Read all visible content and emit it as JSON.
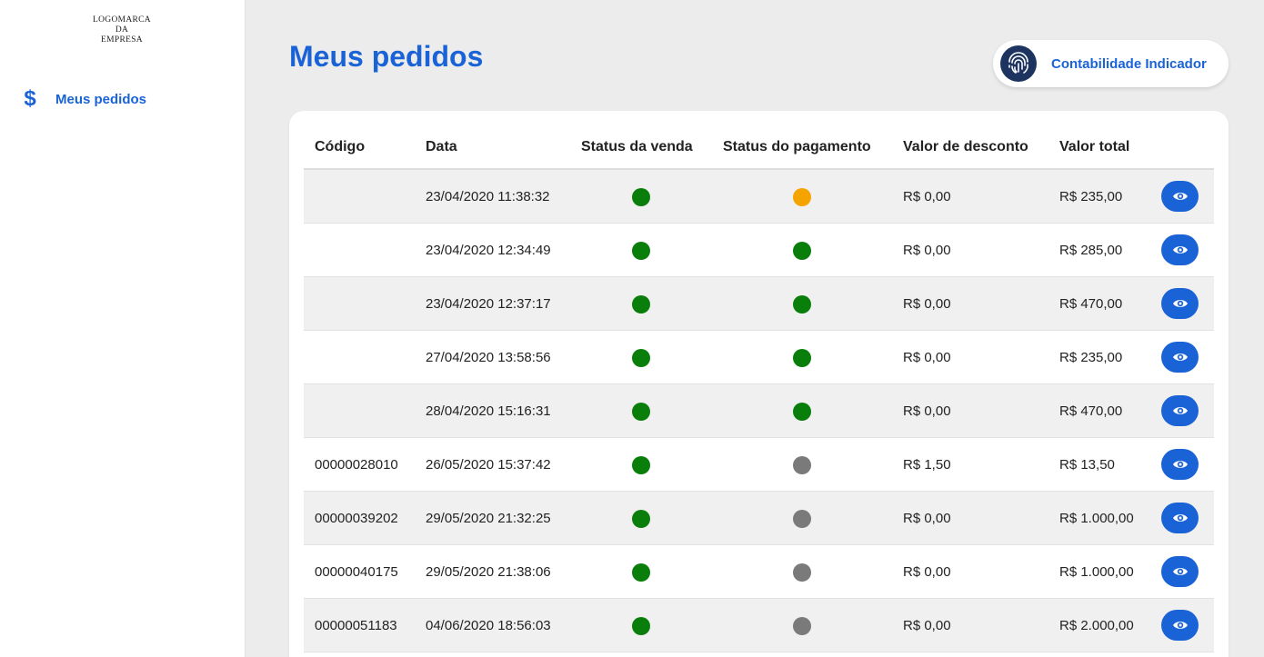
{
  "sidebar": {
    "logo_lines": [
      "LOGOMARCA",
      "DA",
      "EMPRESA"
    ],
    "items": [
      {
        "label": "Meus pedidos",
        "icon": "dollar-icon"
      }
    ]
  },
  "header": {
    "title": "Meus pedidos",
    "account": {
      "name": "Contabilidade Indicador",
      "avatar_icon": "fingerprint-icon"
    }
  },
  "colors": {
    "accent": "#1a63d6",
    "status_ok": "#0a7e0a",
    "status_pending": "#f5a300",
    "status_unknown": "#7a7a7a"
  },
  "table": {
    "columns": [
      "Código",
      "Data",
      "Status da venda",
      "Status do pagamento",
      "Valor de desconto",
      "Valor total"
    ],
    "rows": [
      {
        "codigo": "",
        "data": "23/04/2020 11:38:32",
        "status_venda": "green",
        "status_pagamento": "orange",
        "desconto": "R$ 0,00",
        "total": "R$ 235,00"
      },
      {
        "codigo": "",
        "data": "23/04/2020 12:34:49",
        "status_venda": "green",
        "status_pagamento": "green",
        "desconto": "R$ 0,00",
        "total": "R$ 285,00"
      },
      {
        "codigo": "",
        "data": "23/04/2020 12:37:17",
        "status_venda": "green",
        "status_pagamento": "green",
        "desconto": "R$ 0,00",
        "total": "R$ 470,00"
      },
      {
        "codigo": "",
        "data": "27/04/2020 13:58:56",
        "status_venda": "green",
        "status_pagamento": "green",
        "desconto": "R$ 0,00",
        "total": "R$ 235,00"
      },
      {
        "codigo": "",
        "data": "28/04/2020 15:16:31",
        "status_venda": "green",
        "status_pagamento": "green",
        "desconto": "R$ 0,00",
        "total": "R$ 470,00"
      },
      {
        "codigo": "00000028010",
        "data": "26/05/2020 15:37:42",
        "status_venda": "green",
        "status_pagamento": "gray",
        "desconto": "R$ 1,50",
        "total": "R$ 13,50"
      },
      {
        "codigo": "00000039202",
        "data": "29/05/2020 21:32:25",
        "status_venda": "green",
        "status_pagamento": "gray",
        "desconto": "R$ 0,00",
        "total": "R$ 1.000,00"
      },
      {
        "codigo": "00000040175",
        "data": "29/05/2020 21:38:06",
        "status_venda": "green",
        "status_pagamento": "gray",
        "desconto": "R$ 0,00",
        "total": "R$ 1.000,00"
      },
      {
        "codigo": "00000051183",
        "data": "04/06/2020 18:56:03",
        "status_venda": "green",
        "status_pagamento": "gray",
        "desconto": "R$ 0,00",
        "total": "R$ 2.000,00"
      }
    ],
    "row_action_icon": "eye-icon"
  }
}
